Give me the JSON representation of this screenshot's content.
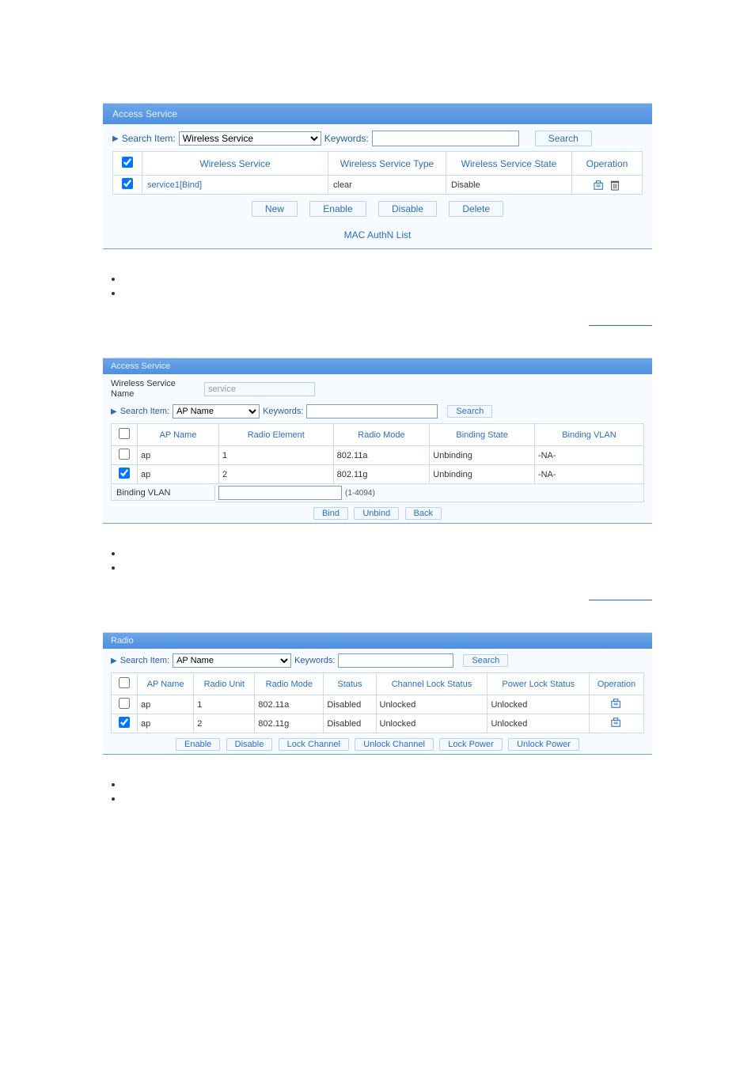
{
  "panel1": {
    "title": "Access Service",
    "search": {
      "label": "Search Item:",
      "select_value": "Wireless Service",
      "keywords_label": "Keywords:",
      "keywords_value": "",
      "search_btn": "Search"
    },
    "table": {
      "headers": {
        "service": "Wireless Service",
        "type": "Wireless Service Type",
        "state": "Wireless Service State",
        "operation": "Operation"
      },
      "rows": [
        {
          "checked": true,
          "service_link": "service1[Bind]",
          "type": "clear",
          "state": "Disable"
        }
      ]
    },
    "buttons": {
      "new": "New",
      "enable": "Enable",
      "disable": "Disable",
      "delete": "Delete"
    },
    "mac_link": "MAC AuthN List"
  },
  "panel2": {
    "title": "Access Service",
    "svc_name_label": "Wireless Service Name",
    "svc_name_value": "service",
    "search": {
      "label": "Search Item:",
      "select_value": "AP Name",
      "keywords_label": "Keywords:",
      "keywords_value": "",
      "search_btn": "Search"
    },
    "table": {
      "headers": {
        "ap": "AP Name",
        "elem": "Radio Element",
        "mode": "Radio Mode",
        "state": "Binding State",
        "vlan": "Binding VLAN"
      },
      "rows": [
        {
          "checked": false,
          "ap": "ap",
          "elem": "1",
          "mode": "802.11a",
          "state": "Unbinding",
          "vlan": "-NA-"
        },
        {
          "checked": true,
          "ap": "ap",
          "elem": "2",
          "mode": "802.11g",
          "state": "Unbinding",
          "vlan": "-NA-"
        }
      ]
    },
    "bindvlan": {
      "label": "Binding VLAN",
      "value": "",
      "hint": "(1-4094)"
    },
    "buttons": {
      "bind": "Bind",
      "unbind": "Unbind",
      "back": "Back"
    }
  },
  "panel3": {
    "title": "Radio",
    "search": {
      "label": "Search Item:",
      "select_value": "AP Name",
      "keywords_label": "Keywords:",
      "keywords_value": "",
      "search_btn": "Search"
    },
    "table": {
      "headers": {
        "ap": "AP Name",
        "unit": "Radio Unit",
        "mode": "Radio Mode",
        "status": "Status",
        "chlock": "Channel Lock Status",
        "pwlock": "Power Lock Status",
        "op": "Operation"
      },
      "rows": [
        {
          "checked": false,
          "ap": "ap",
          "unit": "1",
          "mode": "802.11a",
          "status": "Disabled",
          "chlock": "Unlocked",
          "pwlock": "Unlocked"
        },
        {
          "checked": true,
          "ap": "ap",
          "unit": "2",
          "mode": "802.11g",
          "status": "Disabled",
          "chlock": "Unlocked",
          "pwlock": "Unlocked"
        }
      ]
    },
    "buttons": {
      "enable": "Enable",
      "disable": "Disable",
      "lockch": "Lock Channel",
      "unlockch": "Unlock Channel",
      "lockpw": "Lock Power",
      "unlockpw": "Unlock Power"
    }
  }
}
